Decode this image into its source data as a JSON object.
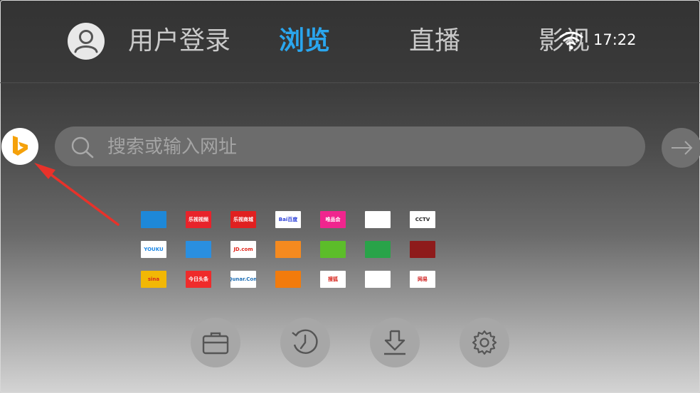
{
  "nav": {
    "user_tab": "用户登录",
    "tabs": [
      {
        "label": "浏览",
        "active": true
      },
      {
        "label": "直播",
        "active": false
      },
      {
        "label": "影视",
        "active": false
      }
    ]
  },
  "status": {
    "time": "17:22",
    "wifi_icon": "wifi-icon"
  },
  "search": {
    "placeholder": "搜索或输入网址",
    "engine_icon": "bing-icon",
    "go_icon": "arrow-right-icon"
  },
  "annotation": {
    "color": "#e8322a"
  },
  "shortcuts": [
    {
      "label": "",
      "bg": "#1e88d8",
      "fg": "#ffffff"
    },
    {
      "label": "乐视视频",
      "bg": "#e8232b",
      "fg": "#ffffff"
    },
    {
      "label": "乐视商城",
      "bg": "#e02020",
      "fg": "#ffffff"
    },
    {
      "label": "Bai百度",
      "bg": "#ffffff",
      "fg": "#2b3fd9"
    },
    {
      "label": "唯品会",
      "bg": "#f0258e",
      "fg": "#ffffff"
    },
    {
      "label": "",
      "bg": "#ffffff",
      "fg": "#6a3fd0"
    },
    {
      "label": "CCTV",
      "bg": "#ffffff",
      "fg": "#222222"
    },
    {
      "label": "YOUKU",
      "bg": "#ffffff",
      "fg": "#1e88e5"
    },
    {
      "label": "",
      "bg": "#2a8fe0",
      "fg": "#ffffff"
    },
    {
      "label": "JD.com",
      "bg": "#ffffff",
      "fg": "#e1251b"
    },
    {
      "label": "",
      "bg": "#f58a1f",
      "fg": "#ffffff"
    },
    {
      "label": "",
      "bg": "#5cbd2a",
      "fg": "#ffffff"
    },
    {
      "label": "",
      "bg": "#29a349",
      "fg": "#ffffff"
    },
    {
      "label": "",
      "bg": "#8e1b1b",
      "fg": "#ffffff"
    },
    {
      "label": "sina",
      "bg": "#f2b705",
      "fg": "#d52b1e"
    },
    {
      "label": "今日头条",
      "bg": "#ef2b2b",
      "fg": "#ffffff"
    },
    {
      "label": "Qunar.Com",
      "bg": "#ffffff",
      "fg": "#1f6fb5"
    },
    {
      "label": "",
      "bg": "#f27b0c",
      "fg": "#ffffff"
    },
    {
      "label": "搜狐",
      "bg": "#ffffff",
      "fg": "#d8261d"
    },
    {
      "label": "",
      "bg": "#ffffff",
      "fg": "#1aa06a"
    },
    {
      "label": "网易",
      "bg": "#ffffff",
      "fg": "#d0201f"
    }
  ],
  "tools": [
    {
      "icon": "folder-icon",
      "name": "files-button"
    },
    {
      "icon": "history-icon",
      "name": "history-button"
    },
    {
      "icon": "download-icon",
      "name": "download-button"
    },
    {
      "icon": "gear-icon",
      "name": "settings-button"
    }
  ]
}
